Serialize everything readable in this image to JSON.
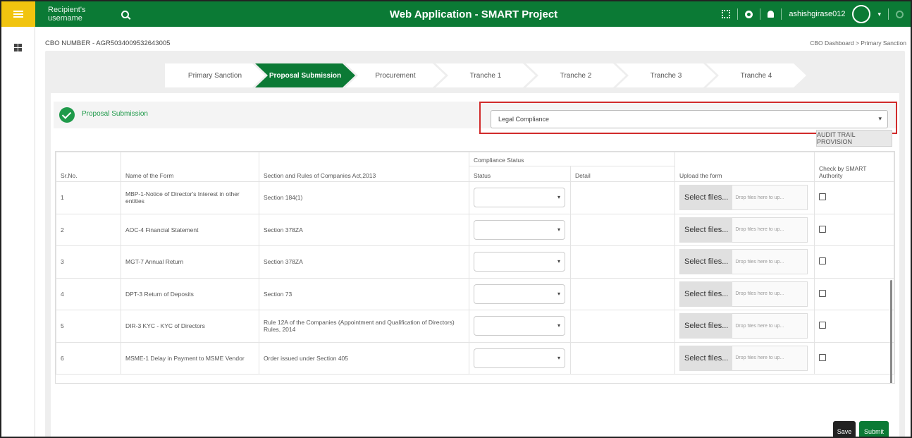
{
  "header": {
    "search_placeholder": "Recipient's username",
    "app_title": "Web Application - SMART Project",
    "username": "ashishgirase012"
  },
  "page": {
    "cbo_number": "CBO NUMBER - AGR5034009532643005",
    "breadcrumb": "CBO Dashboard  >  Primary Sanction"
  },
  "steps": [
    {
      "label": "Primary Sanction",
      "active": false
    },
    {
      "label": "Proposal Submission",
      "active": true
    },
    {
      "label": "Procurement",
      "active": false
    },
    {
      "label": "Tranche 1",
      "active": false
    },
    {
      "label": "Tranche 2",
      "active": false
    },
    {
      "label": "Tranche 3",
      "active": false
    },
    {
      "label": "Tranche 4",
      "active": false
    }
  ],
  "section": {
    "label": "Proposal Submission",
    "compliance_select": "Legal Compliance",
    "audit_button": "AUDIT TRAIL PROVISION"
  },
  "table": {
    "group_header": "Compliance Status",
    "headers": {
      "srno": "Sr.No.",
      "form": "Name of the Form",
      "section": "Section and Rules of Companies Act,2013",
      "status": "Status",
      "detail": "Detail",
      "upload": "Upload the form",
      "check": "Check by SMART Authority"
    },
    "select_files_label": "Select files...",
    "drop_hint": "Drop files here to up...",
    "rows": [
      {
        "sr": "1",
        "form": "MBP-1-Notice of Director's Interest in other entities",
        "section": "Section 184(1)"
      },
      {
        "sr": "2",
        "form": "AOC-4 Financial Statement",
        "section": "Section 378ZA"
      },
      {
        "sr": "3",
        "form": "MGT-7 Annual Return",
        "section": "Section 378ZA"
      },
      {
        "sr": "4",
        "form": "DPT-3 Return of Deposits",
        "section": "Section 73"
      },
      {
        "sr": "5",
        "form": "DIR-3 KYC - KYC of Directors",
        "section": "Rule 12A of the Companies (Appointment and Qualification of Directors) Rules, 2014"
      },
      {
        "sr": "6",
        "form": "MSME-1 Delay in Payment to MSME Vendor",
        "section": "Order issued under Section 405"
      }
    ]
  },
  "actions": {
    "save": "Save",
    "submit": "Submit"
  },
  "colors": {
    "brand_green": "#0b7a35",
    "accent_yellow": "#f1c40f",
    "highlight_red": "#d12b2b"
  }
}
